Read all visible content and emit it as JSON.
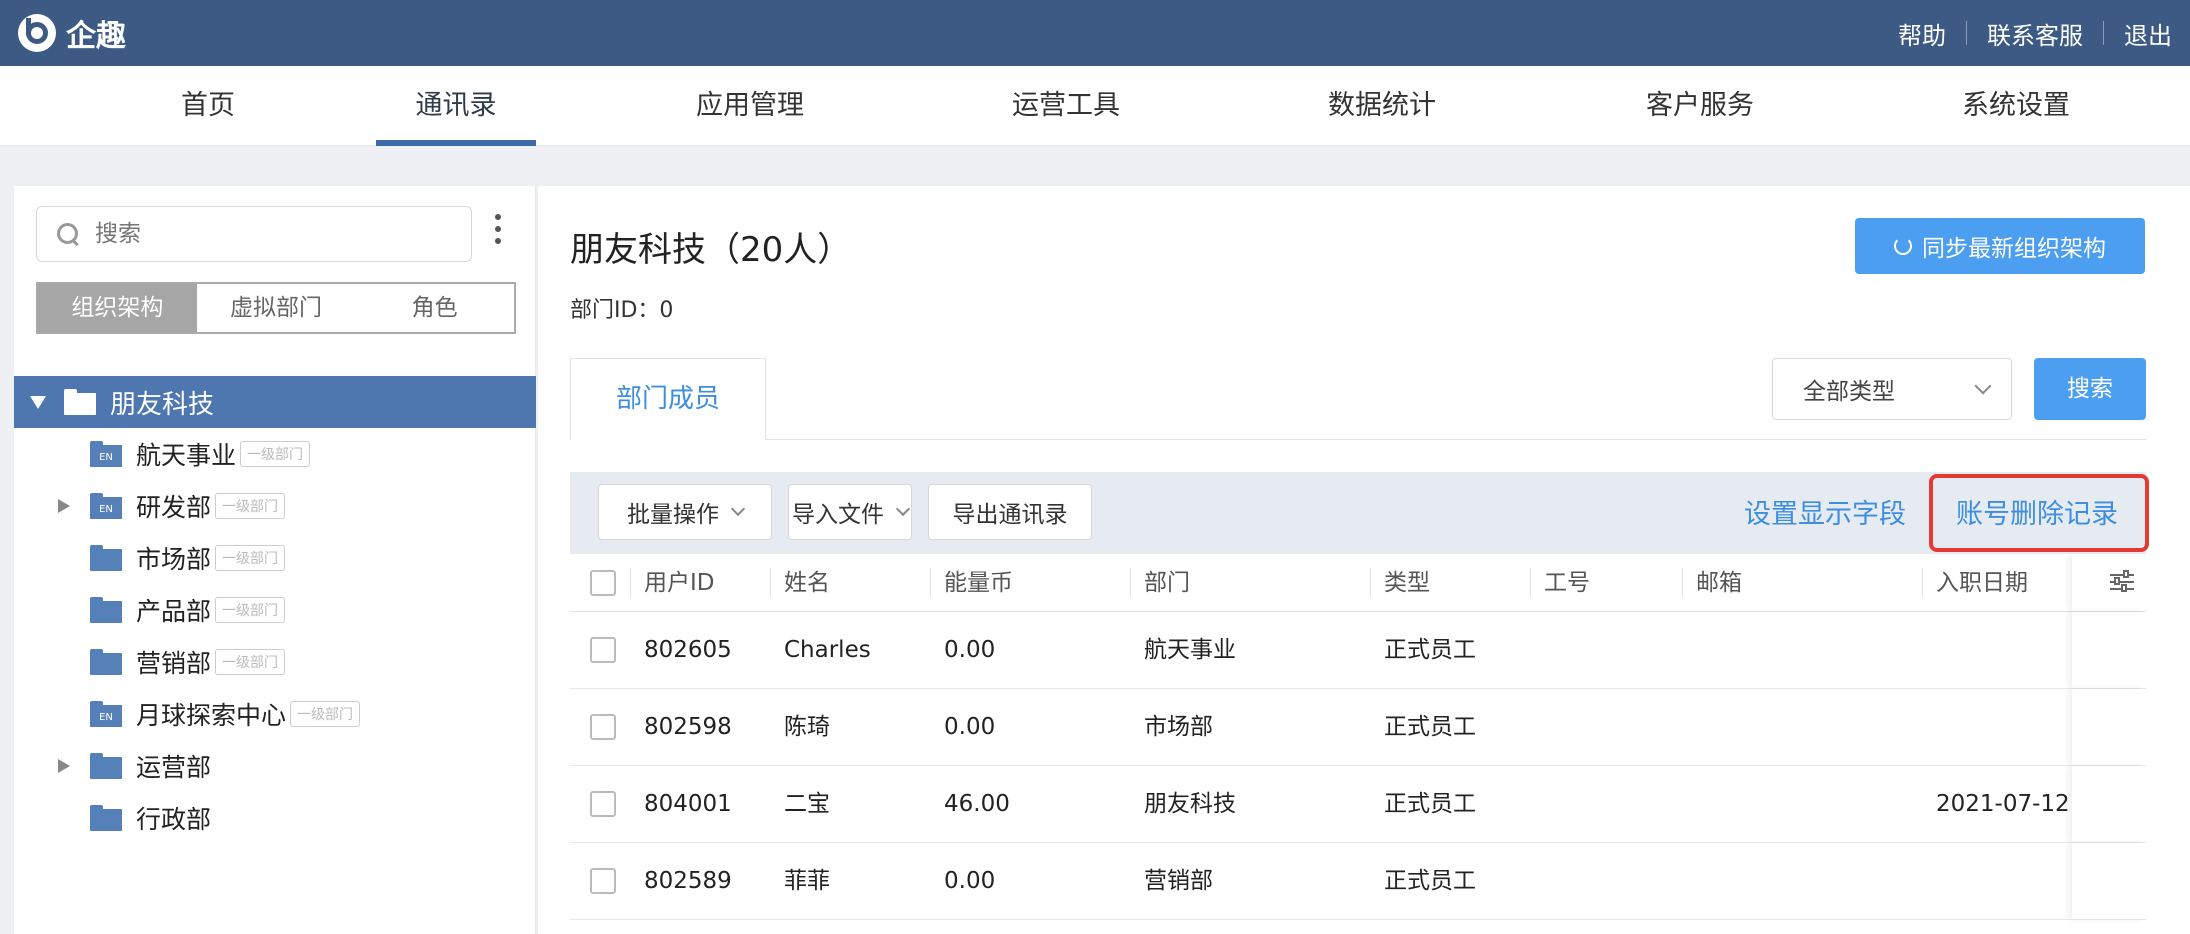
{
  "app": {
    "name": "企趣"
  },
  "top_links": [
    "帮助",
    "联系客服",
    "退出"
  ],
  "nav": [
    {
      "label": "首页"
    },
    {
      "label": "通讯录",
      "active": true
    },
    {
      "label": "应用管理"
    },
    {
      "label": "运营工具"
    },
    {
      "label": "数据统计"
    },
    {
      "label": "客户服务"
    },
    {
      "label": "系统设置"
    }
  ],
  "sidebar": {
    "search_placeholder": "搜索",
    "segments": [
      "组织架构",
      "虚拟部门",
      "角色"
    ],
    "active_segment": "组织架构",
    "root": "朋友科技",
    "items": [
      {
        "label": "航天事业",
        "tag": "一级部门",
        "icon": "en-folder-icon",
        "expandable": false
      },
      {
        "label": "研发部",
        "tag": "一级部门",
        "icon": "en-folder-icon",
        "expandable": true
      },
      {
        "label": "市场部",
        "tag": "一级部门",
        "icon": "folder-icon",
        "expandable": false
      },
      {
        "label": "产品部",
        "tag": "一级部门",
        "icon": "folder-icon",
        "expandable": false
      },
      {
        "label": "营销部",
        "tag": "一级部门",
        "icon": "folder-icon",
        "expandable": false
      },
      {
        "label": "月球探索中心",
        "tag": "一级部门",
        "icon": "en-folder-icon",
        "expandable": false
      },
      {
        "label": "运营部",
        "tag": "",
        "icon": "folder-icon",
        "expandable": true
      },
      {
        "label": "行政部",
        "tag": "",
        "icon": "folder-icon",
        "expandable": false
      }
    ]
  },
  "main": {
    "title": "朋友科技（20人）",
    "dept_id": "部门ID：0",
    "sync_label": "同步最新组织架构",
    "tab": "部门成员",
    "type_select": "全部类型",
    "search_label": "搜索",
    "batch_label": "批量操作",
    "import_label": "导入文件",
    "export_label": "导出通讯录",
    "display_fields_label": "设置显示字段",
    "delete_records_label": "账号删除记录"
  },
  "table": {
    "columns": [
      "用户ID",
      "姓名",
      "能量币",
      "部门",
      "类型",
      "工号",
      "邮箱",
      "入职日期"
    ],
    "rows": [
      [
        "802605",
        "Charles",
        "0.00",
        "航天事业",
        "正式员工",
        "",
        "",
        ""
      ],
      [
        "802598",
        "陈琦",
        "0.00",
        "市场部",
        "正式员工",
        "",
        "",
        ""
      ],
      [
        "804001",
        "二宝",
        "46.00",
        "朋友科技",
        "正式员工",
        "",
        "",
        "2021-07-12"
      ],
      [
        "802589",
        "菲菲",
        "0.00",
        "营销部",
        "正式员工",
        "",
        "",
        ""
      ]
    ]
  },
  "colors": {
    "topbar": "#3d5a85",
    "accent": "#4b9ef0",
    "highlight": "#e53935"
  }
}
